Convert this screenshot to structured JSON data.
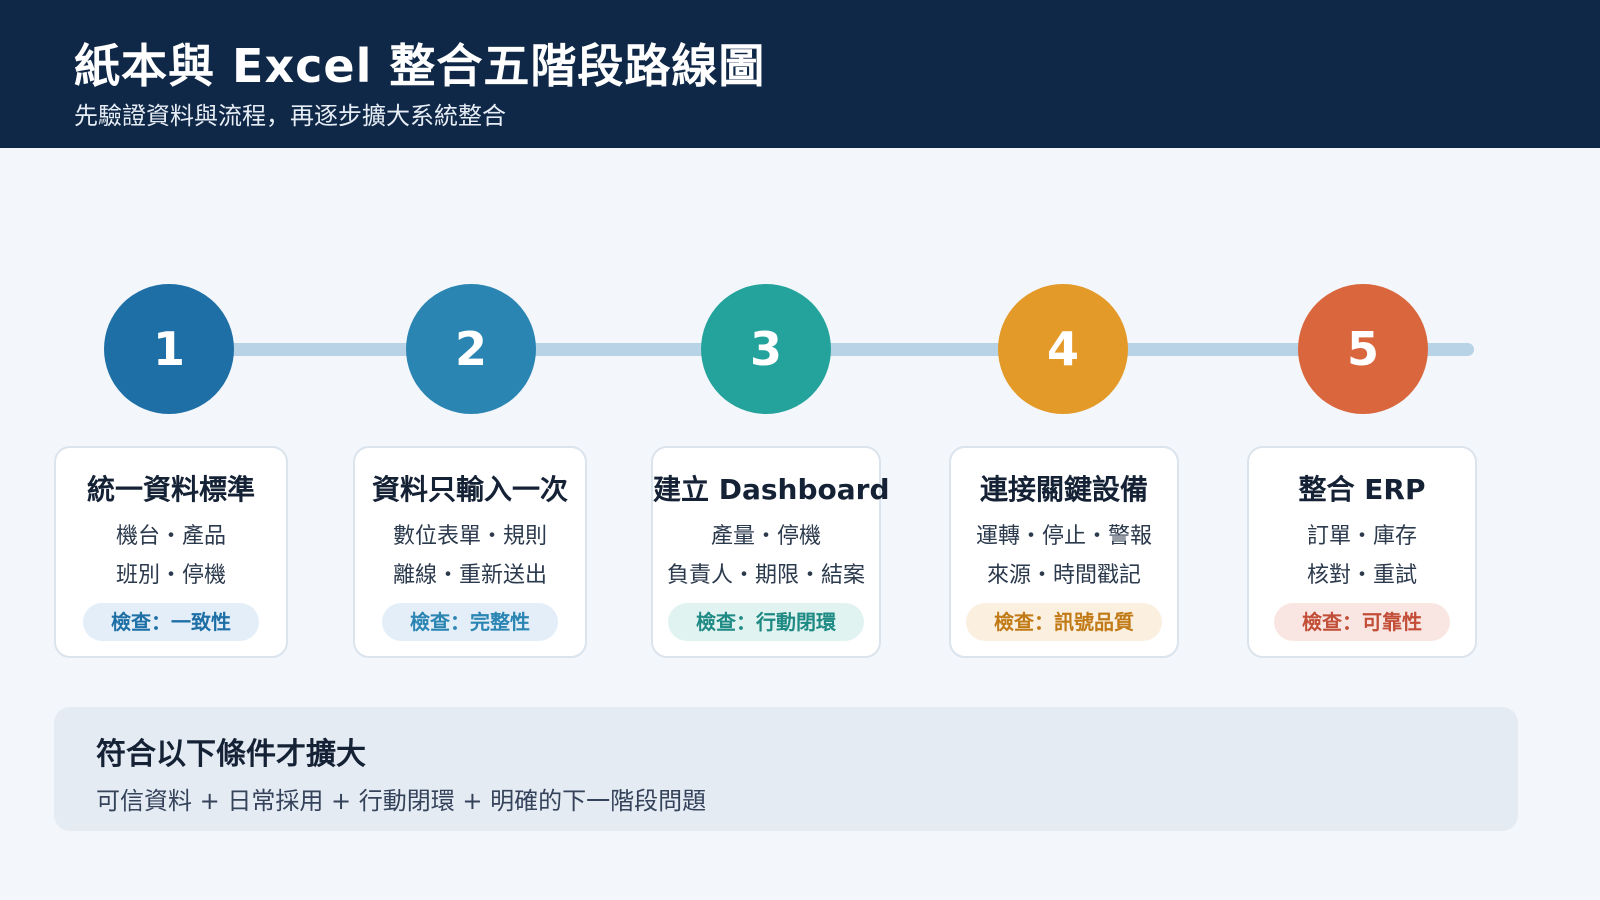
{
  "header": {
    "title": "紙本與 Excel 整合五階段路線圖",
    "subtitle": "先驗證資料與流程，再逐步擴大系統整合"
  },
  "stages": [
    {
      "number": "1",
      "title": "統一資料標準",
      "line1": "機台・產品",
      "line2": "班別・停機",
      "check": "檢查：一致性",
      "color": "#1e6fa6",
      "badge_bg": "#e3eef8",
      "badge_fg": "#1e6fa6"
    },
    {
      "number": "2",
      "title": "資料只輸入一次",
      "line1": "數位表單・規則",
      "line2": "離線・重新送出",
      "check": "檢查：完整性",
      "color": "#2a85b3",
      "badge_bg": "#e3eef8",
      "badge_fg": "#2a85b3"
    },
    {
      "number": "3",
      "title": "建立 Dashboard",
      "line1": "產量・停機",
      "line2": "負責人・期限・結案",
      "check": "檢查：行動閉環",
      "color": "#23a39c",
      "badge_bg": "#e1f3f1",
      "badge_fg": "#1f8a84"
    },
    {
      "number": "4",
      "title": "連接關鍵設備",
      "line1": "運轉・停止・警報",
      "line2": "來源・時間戳記",
      "check": "檢查：訊號品質",
      "color": "#e39a29",
      "badge_bg": "#fbefdf",
      "badge_fg": "#c17a16"
    },
    {
      "number": "5",
      "title": "整合 ERP",
      "line1": "訂單・庫存",
      "line2": "核對・重試",
      "check": "檢查：可靠性",
      "color": "#d9663d",
      "badge_bg": "#f9e6e2",
      "badge_fg": "#c24e38"
    }
  ],
  "conditions": {
    "title": "符合以下條件才擴大",
    "text": "可信資料 + 日常採用 + 行動閉環 + 明確的下一階段問題"
  }
}
